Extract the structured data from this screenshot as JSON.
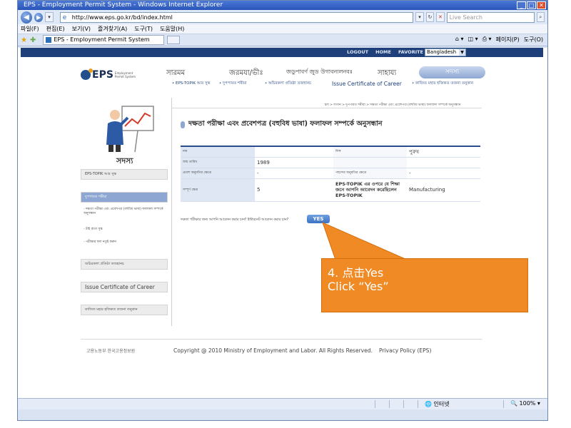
{
  "window": {
    "title": "EPS - Employment Permit System - Windows Internet Explorer"
  },
  "addressbar": {
    "url": "http://www.eps.go.kr/bd/index.html",
    "search_placeholder": "Live Search"
  },
  "menubar": {
    "items": [
      "파일(F)",
      "편집(E)",
      "보기(V)",
      "즐겨찾기(A)",
      "도구(T)",
      "도움말(H)"
    ]
  },
  "tabs": {
    "active": "EPS - Employment Permit System"
  },
  "toolbar": {
    "page_label": "페이지(P)",
    "tools_label": "도구(O)"
  },
  "topnav": {
    "logout": "LOGOUT",
    "home": "HOME",
    "favorite": "FAVORITE",
    "country": "Bangladesh"
  },
  "logo": {
    "text": "EPS",
    "sub": "Employment Permit System"
  },
  "mainmenu": {
    "items": [
      "সারমম",
      "জরমযা/ভীঃ",
      "জডুপাবর্ণ জুড উগাবন্যলনবঃ",
      "সাহায্য"
    ],
    "active": "সদস্য"
  },
  "submenu": {
    "items": [
      "• EPS-TOPIK আর সুন্ত",
      "• দুপপাবত শৰীয়া",
      "• অচিরকলা প্রতিষ্ঠা তজহানচ",
      "Issue Certificate of Career",
      "• কাজিত মহার হজিকত তজনা তনুকান"
    ]
  },
  "breadcrumb": "হল > লগান > দুপপাবত শৰীয়া > দক্ষতা পরীক্ষা এবং প্রবেশপত্র (বহুবিধ ভাষা) ফলাফল সম্পর্কে অনুসন্ধান",
  "left": {
    "title": "সদস্য",
    "items": [
      {
        "label": "EPS-TOPIK আর সুন্ত",
        "active": false
      },
      {
        "label": "দুপপাবত শৰীয়া",
        "active": true
      }
    ],
    "subitems": [
      "- দক্ষতা পরীক্ষা এবং প্রবেশপত্র (বহুবিধ ভাষা) ফলাফল সম্পর্কে অনুসন্ধান",
      "- টাই রাতা সুন্ত",
      "- পরীক্ষার ফল নতুই করুন"
    ],
    "bottom_items": [
      "অচিরকলা প্রতিষ্ঠা তজহানচ",
      "Issue Certificate of Career",
      "কাজিত মহার হজিকত তজনা তনুকান"
    ]
  },
  "heading": "দক্ষতা পরীক্ষা এবং প্রবেশপত্র (বহুবিধ ভাষা) ফলাফল সম্পর্কে অনুসন্ধান",
  "table": {
    "rows": [
      {
        "l1": "নাম",
        "v1": "",
        "l2": "লিঙ্গ",
        "v2": "পুরুষ"
      },
      {
        "l1": "জন্ম তারিখ",
        "v1": "1989",
        "l2": "",
        "v2": ""
      },
      {
        "l1": "প্রবেশ অনুমতির ক্ষেত্রে",
        "v1": "-",
        "l2": "পছন্দের অনুমতির ক্ষেত্রে",
        "v2": "-"
      },
      {
        "l1": "সম্পূর্ণ ক্ষেত্র",
        "v1": "5",
        "l2": "EPS-TOPIK এর ওপরে যে শিক্ষা জনে আপনি আবেদন করেছিলেন EPS-TOPIK",
        "v2": "Manufacturing"
      }
    ]
  },
  "question": "দক্ষতা পরীক্ষার জন্য আপনি আবেদন করার চান? ইন্টারনেট আবেদন করার চান?",
  "yes_button": "YES",
  "footer": {
    "logos": "고용노동부  한국고용정보원",
    "copyright": "Copyright @ 2010 Ministry of Employment and Labor. All Rights Reserved.",
    "privacy": "Privacy Policy (EPS)"
  },
  "statusbar": {
    "zone": "인터넷",
    "zoom": "100%"
  },
  "callout": {
    "line1": "4. 点击Yes",
    "line2": "Click “Yes”"
  },
  "colors": {
    "callout": "#f08a24",
    "nav": "#1e3f79",
    "accent": "#8ea7d2"
  }
}
